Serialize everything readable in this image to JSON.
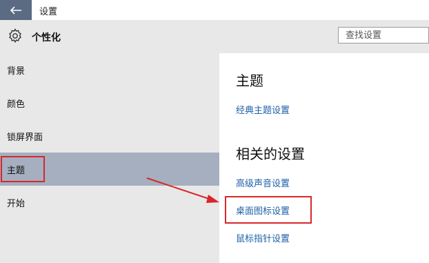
{
  "titlebar": {
    "back_icon": "back-arrow-icon",
    "title": "设置"
  },
  "header": {
    "icon": "gear-icon",
    "title": "个性化"
  },
  "search": {
    "placeholder": "查找设置"
  },
  "sidebar": {
    "items": [
      {
        "label": "背景",
        "selected": false
      },
      {
        "label": "颜色",
        "selected": false
      },
      {
        "label": "锁屏界面",
        "selected": false
      },
      {
        "label": "主题",
        "selected": true
      },
      {
        "label": "开始",
        "selected": false
      }
    ]
  },
  "content": {
    "theme_heading": "主题",
    "classic_theme_link": "经典主题设置",
    "related_heading": "相关的设置",
    "related_links": [
      "高级声音设置",
      "桌面图标设置",
      "鼠标指针设置"
    ]
  },
  "colors": {
    "accent": "#5b6b83",
    "selected": "#a5afbf",
    "link": "#1e5fa8",
    "annotation": "#d8262a"
  }
}
